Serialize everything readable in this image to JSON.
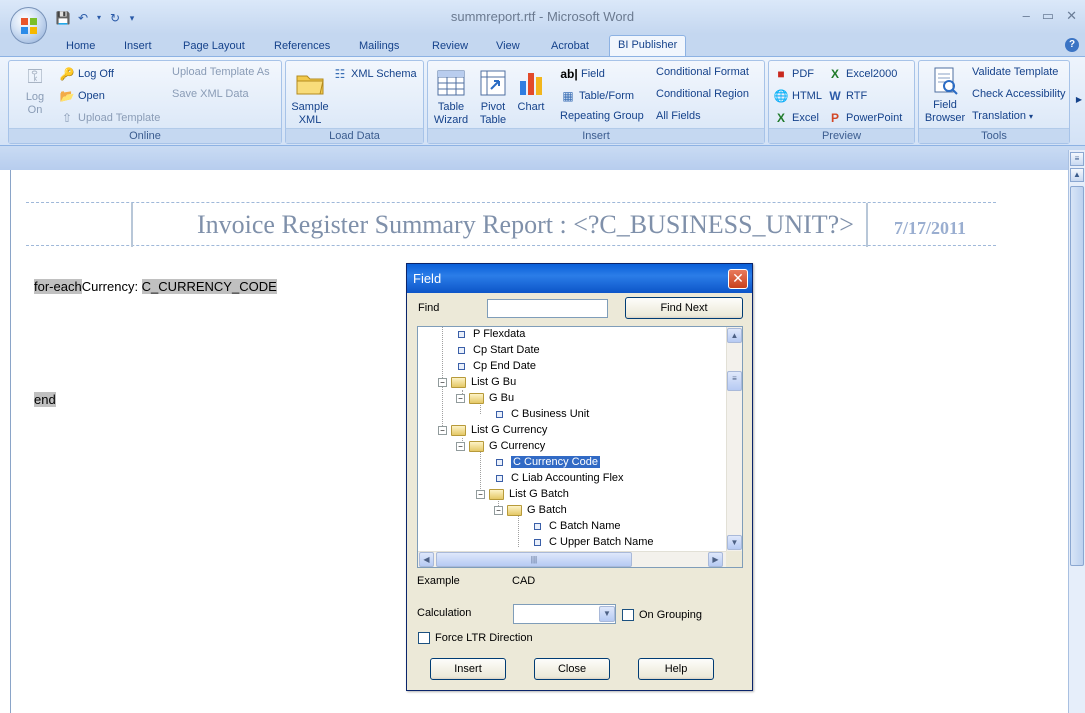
{
  "window": {
    "title": "summreport.rtf - Microsoft Word"
  },
  "tabs": [
    "Home",
    "Insert",
    "Page Layout",
    "References",
    "Mailings",
    "Review",
    "View",
    "Acrobat",
    "BI Publisher"
  ],
  "active_tab": "BI Publisher",
  "ribbon": {
    "online": {
      "label": "Online",
      "log_on": "Log\nOn",
      "log_off": "Log Off",
      "open": "Open",
      "upload_template": "Upload Template",
      "upload_template_as": "Upload Template As",
      "save_xml_data": "Save XML Data"
    },
    "load_data": {
      "label": "Load Data",
      "sample_xml": "Sample\nXML",
      "xml_schema": "XML Schema"
    },
    "insert": {
      "label": "Insert",
      "table_wizard": "Table\nWizard",
      "pivot_table": "Pivot\nTable",
      "chart": "Chart",
      "field": "Field",
      "table_form": "Table/Form",
      "repeating_group": "Repeating Group",
      "conditional_format": "Conditional Format",
      "conditional_region": "Conditional Region",
      "all_fields": "All Fields"
    },
    "preview": {
      "label": "Preview",
      "pdf": "PDF",
      "html": "HTML",
      "excel": "Excel",
      "excel2000": "Excel2000",
      "rtf": "RTF",
      "powerpoint": "PowerPoint"
    },
    "tools": {
      "label": "Tools",
      "field_browser": "Field\nBrowser",
      "validate_template": "Validate Template",
      "check_accessibility": "Check Accessibility",
      "translation": "Translation"
    }
  },
  "document": {
    "report_title": "Invoice Register Summary Report : <?C_BUSINESS_UNIT?>",
    "report_date": "7/17/2011",
    "line1_field": "for-each",
    "line1_text": "Currency: ",
    "line1_code": "C_CURRENCY_CODE",
    "line2_field": "end"
  },
  "dialog": {
    "title": "Field",
    "find_label": "Find",
    "find_value": "",
    "find_next": "Find Next",
    "tree": [
      {
        "label": "P Flexdata",
        "type": "leaf"
      },
      {
        "label": "Cp Start Date",
        "type": "leaf"
      },
      {
        "label": "Cp End Date",
        "type": "leaf"
      },
      {
        "label": "List G Bu",
        "type": "folder"
      },
      {
        "label": "G Bu",
        "type": "folder"
      },
      {
        "label": "C Business Unit",
        "type": "leaf"
      },
      {
        "label": "List G Currency",
        "type": "folder"
      },
      {
        "label": "G Currency",
        "type": "folder"
      },
      {
        "label": "C Currency Code",
        "type": "leaf",
        "selected": true
      },
      {
        "label": "C Liab Accounting Flex",
        "type": "leaf"
      },
      {
        "label": "List G Batch",
        "type": "folder"
      },
      {
        "label": "G Batch",
        "type": "folder"
      },
      {
        "label": "C Batch Name",
        "type": "leaf"
      },
      {
        "label": "C Upper Batch Name",
        "type": "leaf"
      }
    ],
    "example_label": "Example",
    "example_value": "CAD",
    "calculation_label": "Calculation",
    "calculation_value": "",
    "on_grouping": "On Grouping",
    "force_ltr": "Force LTR Direction",
    "insert": "Insert",
    "close": "Close",
    "help": "Help"
  }
}
